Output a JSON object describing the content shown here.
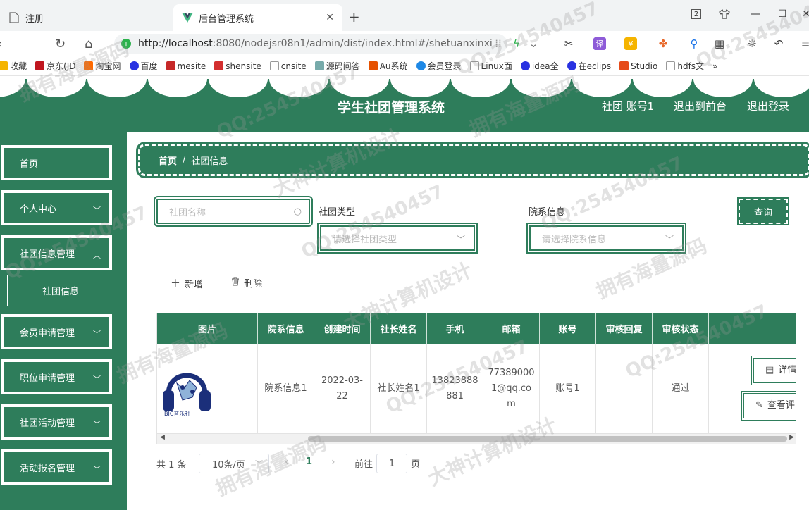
{
  "browser": {
    "tabs": [
      {
        "title": "注册"
      },
      {
        "title": "后台管理系统"
      }
    ],
    "url_prefix": "http://localhost",
    "url_rest": ":8080/nodejsr08n1/admin/dist/index.html#/shetuanxinxi",
    "bookmarks": [
      "收藏",
      "京东(JD",
      "淘宝网",
      "百度",
      "mesite",
      "shensite",
      "cnsite",
      "源码问答",
      "Au系统",
      "会员登录",
      "Linux面",
      "idea全",
      "在eclips",
      "Studio",
      "hdfs文"
    ],
    "badge": "2",
    "translate_icon": "译",
    "colors": {
      "tabbar": "#f1f3f4",
      "active_tab": "#ffffff"
    }
  },
  "header": {
    "title": "学生社团管理系统",
    "user": "社团 账号1",
    "back_to_front": "退出到前台",
    "logout": "退出登录"
  },
  "sidebar": {
    "items": [
      {
        "label": "首页",
        "has_children": false
      },
      {
        "label": "个人中心",
        "has_children": true
      },
      {
        "label": "社团信息管理",
        "has_children": true
      },
      {
        "label": "会员申请管理",
        "has_children": true
      },
      {
        "label": "职位申请管理",
        "has_children": true
      },
      {
        "label": "社团活动管理",
        "has_children": true
      },
      {
        "label": "活动报名管理",
        "has_children": true
      }
    ],
    "sub_item": "社团信息"
  },
  "breadcrumb": {
    "home": "首页",
    "separator": "/",
    "current": "社团信息"
  },
  "filters": {
    "name_placeholder": "社团名称",
    "type_label": "社团类型",
    "type_placeholder": "请选择社团类型",
    "dept_label": "院系信息",
    "dept_placeholder": "请选择院系信息",
    "query_button": "查询"
  },
  "actions": {
    "add": "新增",
    "delete": "删除"
  },
  "table": {
    "headers": [
      "图片",
      "院系信息",
      "创建时间",
      "社长姓名",
      "手机",
      "邮箱",
      "账号",
      "审核回复",
      "审核状态",
      ""
    ],
    "row": {
      "image_caption": "BIC音乐社",
      "dept": "院系信息1",
      "created": "2022-03-22",
      "leader": "社长姓名1",
      "phone": "13823888881",
      "email": "773890001@qq.com",
      "account": "账号1",
      "reply": "",
      "status": "通过",
      "detail_button": "详情",
      "review_button": "查看评"
    }
  },
  "pagination": {
    "total": "共 1 条",
    "page_size": "10条/页",
    "current_page": "1",
    "goto_label": "前往",
    "goto_value": "1",
    "page_suffix": "页"
  },
  "watermark": {
    "line_qq": "QQ:254540457",
    "line_source": "拥有海量源码",
    "line_design": "大神计算机设计"
  },
  "colors": {
    "primary": "#2e7d5b",
    "white": "#ffffff"
  }
}
